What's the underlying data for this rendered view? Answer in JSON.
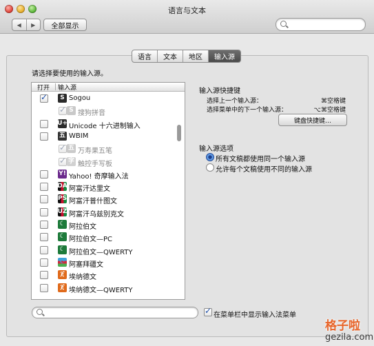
{
  "window": {
    "title": "语言与文本"
  },
  "toolbar": {
    "back": "◀",
    "forward": "▶",
    "show_all": "全部显示",
    "search_placeholder": ""
  },
  "tabs": [
    {
      "label": "语言",
      "active": false
    },
    {
      "label": "文本",
      "active": false
    },
    {
      "label": "地区",
      "active": false
    },
    {
      "label": "输入源",
      "active": true
    }
  ],
  "prompt": "请选择要使用的输入源。",
  "list": {
    "col_enable": "打开",
    "col_source": "输入源",
    "items": [
      {
        "label": "Sogou",
        "checked": true,
        "sub": false,
        "icon": "sogou-icon",
        "icon_text": "S",
        "color": "#1f1f1f"
      },
      {
        "label": "搜狗拼音",
        "checked": true,
        "sub": true,
        "disabled": true,
        "icon": "sogou-pinyin-icon",
        "icon_text": "S",
        "color": "#6b6b6b"
      },
      {
        "label": "Unicode 十六进制输入",
        "checked": false,
        "sub": false,
        "icon": "unicode-hex-icon",
        "icon_text": "U+",
        "color": "#2c2c2c"
      },
      {
        "label": "WBIM",
        "checked": false,
        "sub": false,
        "icon": "wubi-icon",
        "icon_text": "五",
        "color": "#ffffff"
      },
      {
        "label": "万寿果五笔",
        "checked": true,
        "sub": true,
        "disabled": true,
        "icon": "wanshouguo-wubi-icon",
        "icon_text": "五",
        "color": "#ffffff"
      },
      {
        "label": "触控手写板",
        "checked": true,
        "sub": true,
        "disabled": true,
        "icon": "handwriting-icon",
        "icon_text": "字",
        "color": "#777777"
      },
      {
        "label": "Yahoo! 奇摩输入法",
        "checked": false,
        "sub": false,
        "icon": "yahoo-icon",
        "icon_text": "Y!",
        "color": "#6b2a8c"
      },
      {
        "label": "阿富汗达里文",
        "checked": false,
        "sub": false,
        "icon": "flag-afghanistan-icon",
        "icon_text": "DA",
        "color": "#111111"
      },
      {
        "label": "阿富汗普什图文",
        "checked": false,
        "sub": false,
        "icon": "flag-afghanistan-icon",
        "icon_text": "PS",
        "color": "#111111"
      },
      {
        "label": "阿富汗乌兹别克文",
        "checked": false,
        "sub": false,
        "icon": "flag-afghanistan-icon",
        "icon_text": "UZ",
        "color": "#111111"
      },
      {
        "label": "阿拉伯文",
        "checked": false,
        "sub": false,
        "icon": "arabic-crescent-icon",
        "icon_text": "☾",
        "color": "#ffffff"
      },
      {
        "label": "阿拉伯文—PC",
        "checked": false,
        "sub": false,
        "icon": "arabic-pc-icon",
        "icon_text": "☾",
        "color": "#ffffff"
      },
      {
        "label": "阿拉伯文—QWERTY",
        "checked": false,
        "sub": false,
        "icon": "arabic-qwerty-icon",
        "icon_text": "☾",
        "color": "#ffffff"
      },
      {
        "label": "阿塞拜疆文",
        "checked": false,
        "sub": false,
        "icon": "flag-azerbaijan-icon",
        "icon_text": "☪",
        "color": "#3fa3d9"
      },
      {
        "label": "埃纳德文",
        "checked": false,
        "sub": false,
        "icon": "ethiopic-icon",
        "icon_text": "ጀ",
        "color": "#ffffff"
      },
      {
        "label": "埃纳德文—QWERTY",
        "checked": false,
        "sub": false,
        "icon": "ethiopic-qwerty-icon",
        "icon_text": "ጀ",
        "color": "#ffffff"
      }
    ]
  },
  "shortcuts": {
    "title": "输入源快捷键",
    "prev_label": "选择上一个输入源：",
    "prev_key": "⌘空格键",
    "next_label": "选择菜单中的下一个输入源：",
    "next_key": "⌥⌘空格键",
    "button": "键盘快捷键…"
  },
  "options": {
    "title": "输入源选项",
    "same": "所有文稿都使用同一个输入源",
    "different": "允许每个文稿使用不同的输入源",
    "selected": "same"
  },
  "bottom": {
    "search_placeholder": "",
    "show_menu_label": "在菜单栏中显示输入法菜单",
    "show_menu_checked": true
  },
  "watermark": {
    "line1": "格子啦",
    "line2": "gezila.com"
  }
}
